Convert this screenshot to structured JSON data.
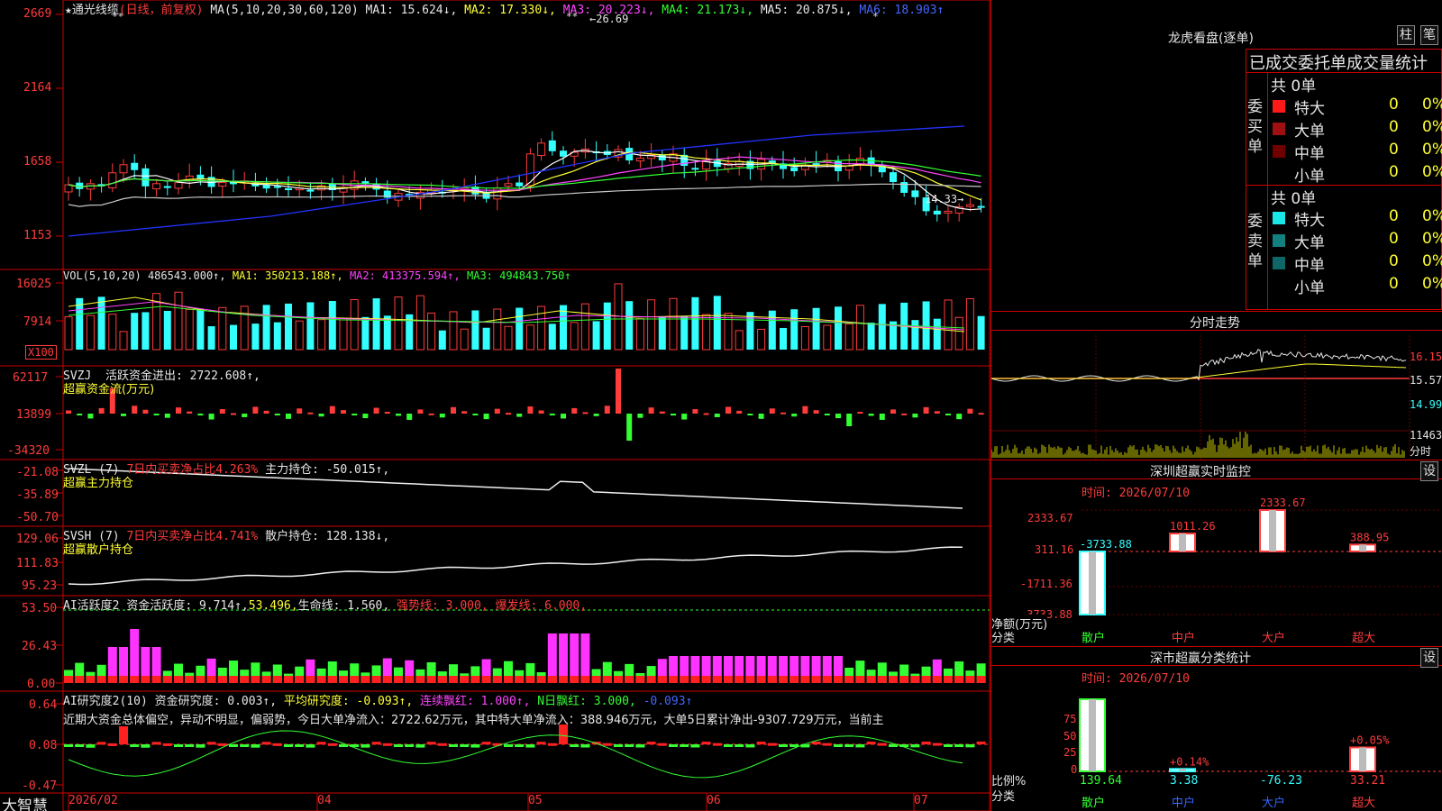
{
  "header": {
    "star": "★",
    "stock_name": "通光线缆",
    "mode": "(日线，前复权)",
    "ma_label": "MA(5,10,20,30,60,120)",
    "ma1": "MA1: 15.624↓,",
    "ma2": "MA2: 17.330↓,",
    "ma3": "MA3: 20.223↓,",
    "ma4": "MA4: 21.173↓,",
    "ma5": "MA5: 20.875↓,",
    "ma6": "MA6: 18.903↑"
  },
  "price_panel": {
    "y_ticks": [
      "2669",
      "2164",
      "1658",
      "1153"
    ],
    "high_label": "26.69",
    "low_label": "14.33→",
    "star_marks": [
      "**",
      "**",
      "*"
    ]
  },
  "vol_panel": {
    "header": "VOL(5,10,20)",
    "v": "486543.000↑,",
    "ma1": "MA1: 350213.188↑,",
    "ma2": "MA2: 413375.594↑,",
    "ma3": "MA3: 494843.750↑",
    "y_ticks": [
      "16025",
      "7914"
    ],
    "unit": "X100"
  },
  "svzj_panel": {
    "name": "SVZJ",
    "label": "活跃资金进出: 2722.608↑,",
    "sub": "超赢资金流(万元)",
    "y_ticks": [
      "62117",
      "13899",
      "-34320"
    ]
  },
  "svzl_panel": {
    "name": "SVZL (7)",
    "ratio": "7日内买卖净占比4.263%",
    "label": "主力持仓: -50.015↑,",
    "sub": "超赢主力持仓",
    "y_ticks": [
      "-21.08",
      "-35.89",
      "-50.70"
    ]
  },
  "svsh_panel": {
    "name": "SVSH (7)",
    "ratio": "7日内买卖净占比4.741%",
    "label": "散户持仓: 128.138↓,",
    "sub": "超赢散户持仓",
    "y_ticks": [
      "129.06",
      "111.83",
      "95.23"
    ]
  },
  "ai_active": {
    "name": "AI活跃度2",
    "a1": "资金活跃度: 9.714↑,",
    "a2": "53.496,",
    "a3": "生命线: 1.560,",
    "a4": "强势线: 3.000,",
    "a5": "爆发线: 6.000,",
    "y_ticks": [
      "53.50",
      "26.43",
      "0.00"
    ]
  },
  "ai_research": {
    "name": "AI研究度2(10)",
    "a1": "资金研究度: 0.003↑,",
    "a2": "平均研究度: -0.093↑,",
    "a3": "连续飘红: 1.000↑,",
    "a4": "N日飘红: 3.000,",
    "a5": "-0.093↑",
    "comment": "近期大资金总体偏空，异动不明显，偏弱势，今日大单净流入：2722.62万元，其中特大单净流入：388.946万元，大单5日累计净出-9307.729万元，当前主",
    "y_ticks": [
      "0.64",
      "0.08",
      "-0.47"
    ]
  },
  "bottom_axis": {
    "app_name": "大智慧",
    "months": [
      "2026/02",
      "04",
      "05",
      "06",
      "07"
    ]
  },
  "right": {
    "title": "龙虎看盘(逐单)",
    "btn_bar": "柱",
    "btn_pen": "笔",
    "tabs": "已成交委托单成交量统计",
    "buy_side": "委买单",
    "sell_side": "委卖单",
    "buy_total": "共 0单",
    "sell_total": "共 0单",
    "rows": [
      "特大",
      "大单",
      "中单",
      "小单"
    ],
    "zero": "0",
    "pct": "0%",
    "intraday_title": "分时走势",
    "intraday_ticks": [
      "16.15",
      "15.57",
      "14.99",
      "11463"
    ],
    "intraday_unit": "分时",
    "monitor_title": "深圳超赢实时监控",
    "monitor_btn": "设",
    "monitor_time": "时间: 2026/07/10",
    "monitor_ticks": [
      "2333.67",
      "311.16",
      "-1711.36",
      "-3733.88"
    ],
    "monitor_unit_1": "净额(万元)",
    "monitor_unit_2": "分类",
    "stats_title": "深市超赢分类统计",
    "stats_btn": "设",
    "stats_time": "时间: 2026/07/10",
    "stats_ticks": [
      "75",
      "50",
      "25",
      "0"
    ],
    "stats_unit_1": "比例%",
    "stats_unit_2": "分类"
  },
  "chart_data": [
    {
      "type": "candlestick",
      "title": "通光线缆 (日线，前复权)",
      "y_range": [
        1153,
        2669
      ],
      "marked_high": 26.69,
      "marked_low": 14.33,
      "ma_latest": {
        "MA1": 15.624,
        "MA2": 17.33,
        "MA3": 20.223,
        "MA4": 21.173,
        "MA5": 20.875,
        "MA6": 18.903
      }
    },
    {
      "type": "bar",
      "title": "VOL(5,10,20)",
      "latest": {
        "VOL": 486543.0,
        "MA1": 350213.188,
        "MA2": 413375.594,
        "MA3": 494843.75
      }
    },
    {
      "type": "bar",
      "title": "SVZJ 活跃资金进出",
      "y_range": [
        -34320,
        62117
      ],
      "latest": 2722.608
    },
    {
      "type": "line",
      "title": "SVZL 主力持仓",
      "y_range": [
        -50.7,
        -21.08
      ],
      "latest": -50.015
    },
    {
      "type": "line",
      "title": "SVSH 散户持仓",
      "y_range": [
        95.23,
        129.06
      ],
      "latest": 128.138
    },
    {
      "type": "bar",
      "title": "AI活跃度2",
      "y_range": [
        0,
        53.5
      ],
      "latest": {
        "资金活跃度": 9.714,
        "value2": 53.496,
        "生命线": 1.56,
        "强势线": 3.0,
        "爆发线": 6.0
      }
    },
    {
      "type": "bar",
      "title": "AI研究度2(10)",
      "y_range": [
        -0.47,
        0.64
      ],
      "latest": {
        "资金研究度": 0.003,
        "平均研究度": -0.093,
        "连续飘红": 1.0,
        "N日飘红": 3.0
      }
    },
    {
      "type": "bar",
      "title": "深圳超赢实时监控",
      "categories": [
        "散户",
        "中户",
        "大户",
        "超大"
      ],
      "values": [
        -3733.88,
        1011.26,
        2333.67,
        388.95
      ],
      "ylabel": "净额(万元)",
      "y_range": [
        -3733.88,
        2333.67
      ]
    },
    {
      "type": "bar",
      "title": "深市超赢分类统计",
      "categories": [
        "散户",
        "中户",
        "大户",
        "超大"
      ],
      "values": [
        139.64,
        3.38,
        -76.23,
        33.21
      ],
      "change_labels": [
        "",
        "+0.14%",
        "",
        "+0.05%"
      ],
      "ylabel": "比例%",
      "y_range": [
        0,
        75
      ]
    }
  ]
}
